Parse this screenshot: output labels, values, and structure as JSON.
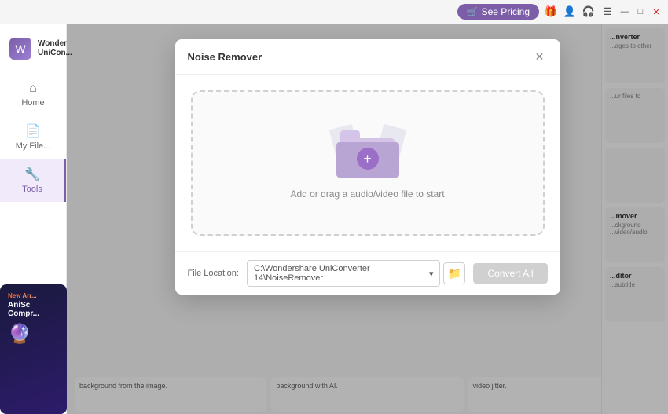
{
  "titlebar": {
    "see_pricing_label": "See Pricing",
    "minimize_label": "—",
    "maximize_label": "□",
    "close_label": "✕"
  },
  "sidebar": {
    "app_name_line1": "Wonder",
    "app_name_line2": "UniCon...",
    "items": [
      {
        "id": "home",
        "label": "Home",
        "icon": "⌂",
        "active": false
      },
      {
        "id": "my-files",
        "label": "My File...",
        "icon": "📄",
        "active": false
      },
      {
        "id": "tools",
        "label": "Tools",
        "icon": "🔧",
        "active": true
      }
    ]
  },
  "right_panel": {
    "cards": [
      {
        "id": "converter",
        "title": "...nverter",
        "desc": "...ages to other"
      },
      {
        "id": "files",
        "title": "",
        "desc": "...ur files to"
      },
      {
        "id": "empty",
        "title": "",
        "desc": ""
      },
      {
        "id": "noise-remover",
        "title": "...mover",
        "desc": "...ckground\n...video/audio"
      },
      {
        "id": "editor",
        "title": "...ditor",
        "desc": "...subtitle"
      }
    ]
  },
  "modal": {
    "title": "Noise Remover",
    "close_label": "✕",
    "drop_zone": {
      "instruction": "Add or drag a audio/video file to start",
      "plus_icon": "+"
    },
    "footer": {
      "file_location_label": "File Location:",
      "file_path": "C:\\Wondershare UniConverter 14\\NoiseRemover",
      "convert_all_label": "Convert All"
    }
  },
  "promo": {
    "badge": "New Arr...",
    "title": "AniSc\nCompr...",
    "icon": "🔮"
  },
  "bottom_cards": {
    "items": [
      {
        "desc": "background from the image."
      },
      {
        "desc": "background with AI."
      },
      {
        "desc": "video jitter."
      }
    ]
  }
}
